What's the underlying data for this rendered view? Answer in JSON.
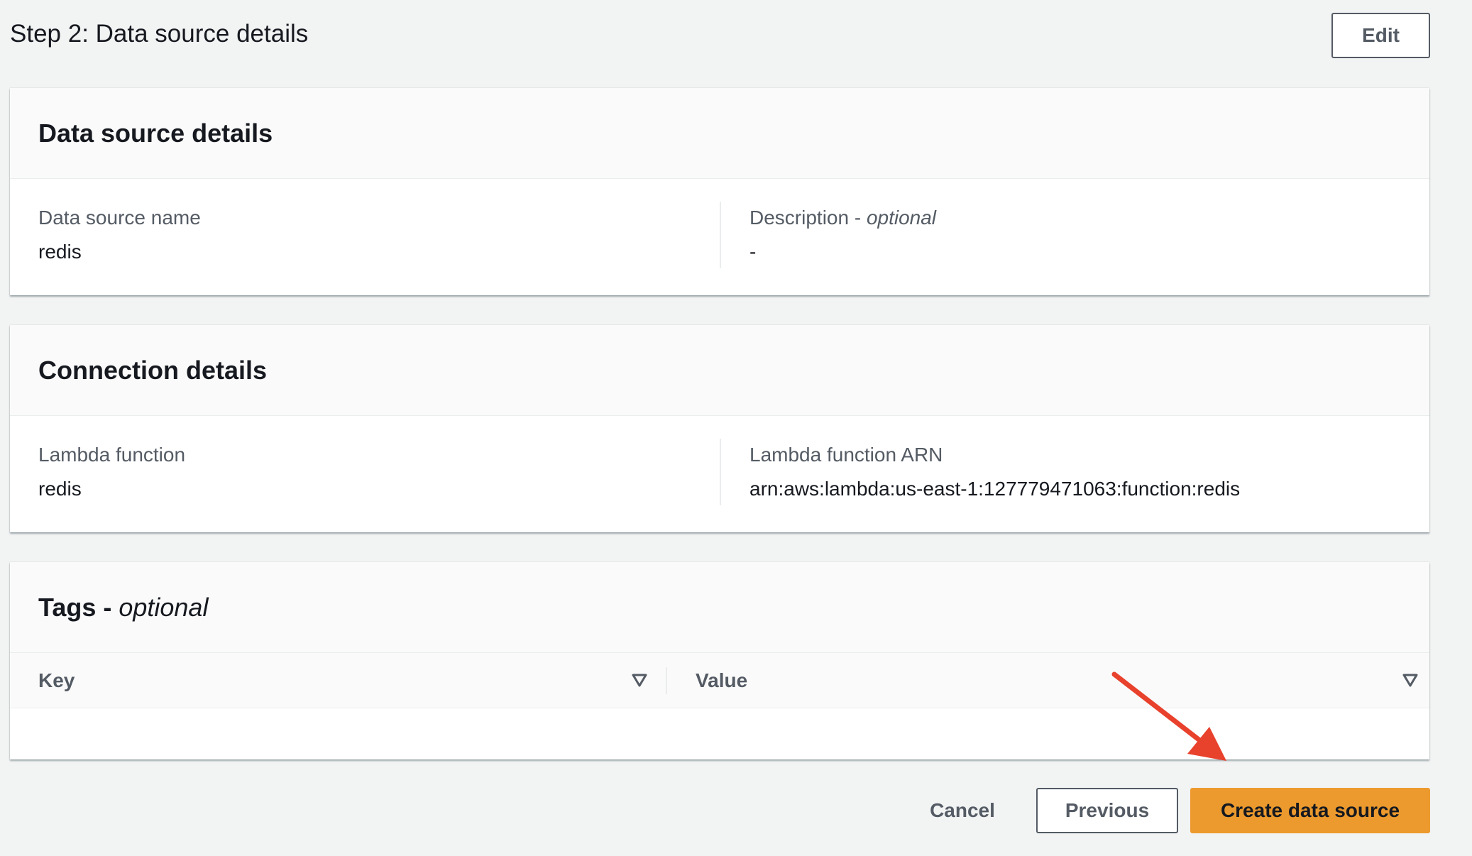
{
  "step": {
    "title": "Step 2: Data source details",
    "edit_label": "Edit"
  },
  "data_source_card": {
    "title": "Data source details",
    "name_label": "Data source name",
    "name_value": "redis",
    "description_label": "Description - ",
    "description_optional": "optional",
    "description_value": "-"
  },
  "connection_card": {
    "title": "Connection details",
    "lambda_label": "Lambda function",
    "lambda_value": "redis",
    "arn_label": "Lambda function ARN",
    "arn_value": "arn:aws:lambda:us-east-1:127779471063:function:redis"
  },
  "tags_card": {
    "title": "Tags - ",
    "title_optional": "optional",
    "columns": [
      "Key",
      "Value"
    ]
  },
  "footer": {
    "cancel_label": "Cancel",
    "previous_label": "Previous",
    "create_label": "Create data source"
  },
  "colors": {
    "primary_button": "#ec9a2e",
    "annotation_arrow": "#e8412c"
  },
  "icons": {
    "sort": "sort-down-triangle-icon",
    "annotation": "red-arrow-icon"
  }
}
